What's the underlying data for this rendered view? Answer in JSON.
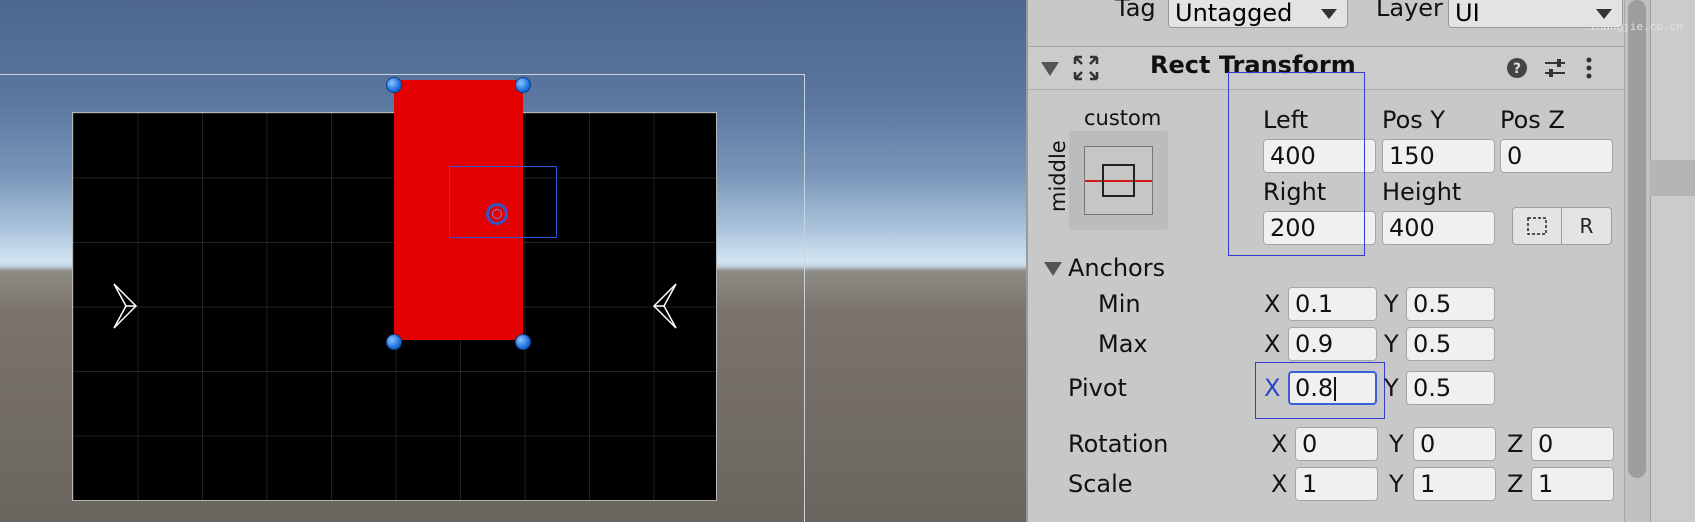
{
  "inspector": {
    "tag_label": "Tag",
    "tag_value": "Untagged",
    "layer_label": "Layer",
    "layer_value": "UI",
    "component_title": "Rect Transform",
    "anchor_preset_top": "custom",
    "anchor_preset_side": "middle",
    "fields": {
      "left_label": "Left",
      "left_value": "400",
      "posy_label": "Pos Y",
      "posy_value": "150",
      "posz_label": "Pos Z",
      "posz_value": "0",
      "right_label": "Right",
      "right_value": "200",
      "height_label": "Height",
      "height_value": "400"
    },
    "blueprint_btn_icon": "dotted-rect-icon",
    "raw_edit_btn_label": "R",
    "anchors": {
      "section_label": "Anchors",
      "min_label": "Min",
      "min_x": "0.1",
      "min_y": "0.5",
      "max_label": "Max",
      "max_x": "0.9",
      "max_y": "0.5"
    },
    "pivot": {
      "label": "Pivot",
      "x": "0.8",
      "y": "0.5"
    },
    "rotation": {
      "label": "Rotation",
      "x": "0",
      "y": "0",
      "z": "0"
    },
    "scale": {
      "label": "Scale",
      "x": "1",
      "y": "1",
      "z": "1"
    },
    "axis": {
      "x": "X",
      "y": "Y",
      "z": "Z"
    }
  },
  "colors": {
    "selected_rect": "#e20000",
    "canvas_panel": "#000000",
    "handle_blue": "#1d6fe0",
    "highlight_outline": "#2e3fd0"
  },
  "watermark": "zhangjie.co.cn"
}
